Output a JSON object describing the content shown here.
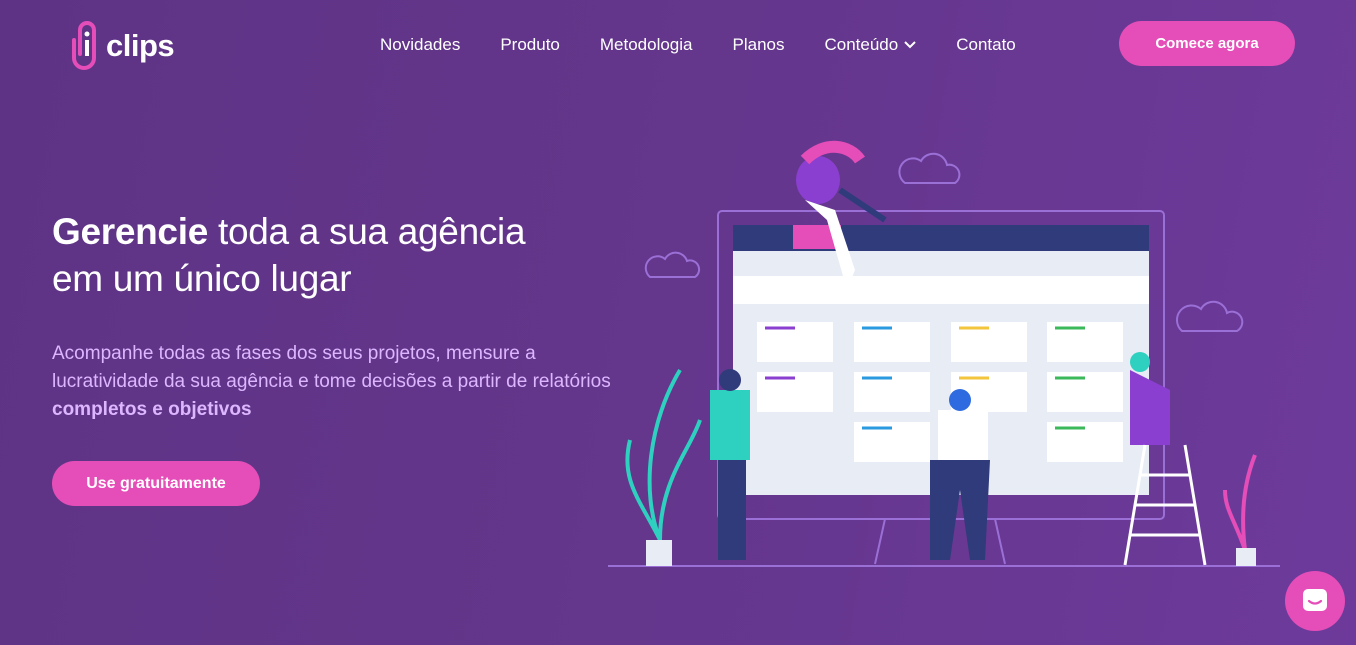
{
  "brand": {
    "name": "clips",
    "accent": "#e54db8",
    "background": "#64368c"
  },
  "nav": {
    "items": [
      {
        "label": "Novidades"
      },
      {
        "label": "Produto"
      },
      {
        "label": "Metodologia"
      },
      {
        "label": "Planos"
      },
      {
        "label": "Conteúdo",
        "dropdown": true
      },
      {
        "label": "Contato"
      }
    ],
    "cta": "Comece agora"
  },
  "hero": {
    "title_bold": "Gerencie",
    "title_rest": " toda a sua agência",
    "title_line2": "em um único lugar",
    "lead_text": "Acompanhe todas as fases dos seus projetos, mensure a lucratividade da sua agência e tome decisões a partir de relatórios ",
    "lead_bold": "completos e objetivos",
    "button": "Use gratuitamente"
  },
  "chat": {
    "icon": "chat-bubble-icon"
  }
}
